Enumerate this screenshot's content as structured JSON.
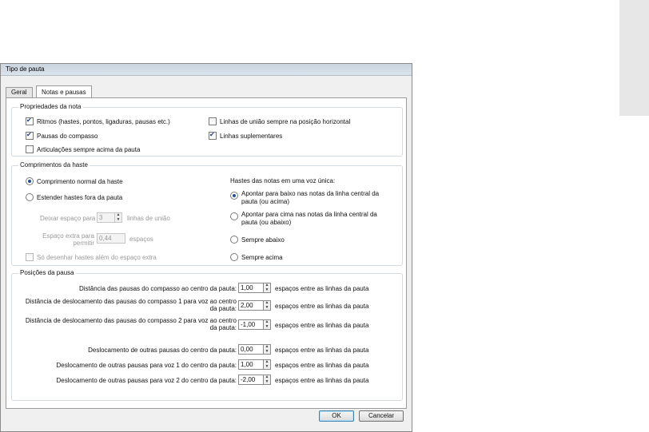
{
  "window": {
    "title": "Tipo de pauta"
  },
  "tabs": [
    {
      "label": "Geral"
    },
    {
      "label": "Notas e pausas"
    }
  ],
  "note_props": {
    "legend": "Propriedades da nota",
    "rhythms": {
      "label": "Ritmos (hastes, pontos, ligaduras, pausas etc.)",
      "checked": true
    },
    "bar_rests": {
      "label": "Pausas do compasso",
      "checked": true
    },
    "articulations": {
      "label": "Articulações sempre acima da pauta",
      "checked": false
    },
    "beams_horizontal": {
      "label": "Linhas de união sempre na posição horizontal",
      "checked": false
    },
    "ledger_lines": {
      "label": "Linhas suplementares",
      "checked": true
    }
  },
  "stem_lengths": {
    "legend": "Comprimentos da haste",
    "normal": {
      "label": "Comprimento normal da haste",
      "selected": true
    },
    "extend": {
      "label": "Estender hastes fora da pauta",
      "selected": false
    },
    "leave_space_prefix": "Deixar espaço para",
    "leave_space_value": "3",
    "leave_space_suffix": "linhas de união",
    "extra_space_label": "Espaço extra para permitir",
    "extra_space_value": "0,44",
    "extra_space_suffix": "espaços",
    "only_beyond": {
      "label": "Só desenhar hastes além do espaço extra",
      "checked": false
    },
    "single_voice_heading": "Hastes das notas em uma voz única:",
    "down_center": {
      "label": "Apontar para baixo nas notas da linha central da pauta (ou acima)",
      "selected": true
    },
    "up_center": {
      "label": "Apontar para cima nas notas da linha central da pauta (ou abaixo)",
      "selected": false
    },
    "always_down": {
      "label": "Sempre abaixo",
      "selected": false
    },
    "always_up": {
      "label": "Sempre acima",
      "selected": false
    }
  },
  "rest_positions": {
    "legend": "Posições da pausa",
    "unit_label": "espaços entre as linhas da pauta",
    "rows": [
      {
        "label": "Distância das pausas do compasso ao centro da pauta:",
        "value": "1,00"
      },
      {
        "label": "Distância de deslocamento das pausas do compasso 1 para voz ao centro da pauta:",
        "value": "2,00"
      },
      {
        "label": "Distância de deslocamento das pausas do compasso 2 para voz ao centro da pauta:",
        "value": "-1,00"
      },
      {
        "label": "Deslocamento de outras pausas do centro da pauta:",
        "value": "0,00"
      },
      {
        "label": "Deslocamento de outras pausas para voz 1 do centro da pauta:",
        "value": "1,00"
      },
      {
        "label": "Deslocamento de outras pausas para voz 2 do centro da pauta:",
        "value": "-2,00"
      }
    ]
  },
  "buttons": {
    "ok": "OK",
    "cancel": "Cancelar"
  }
}
